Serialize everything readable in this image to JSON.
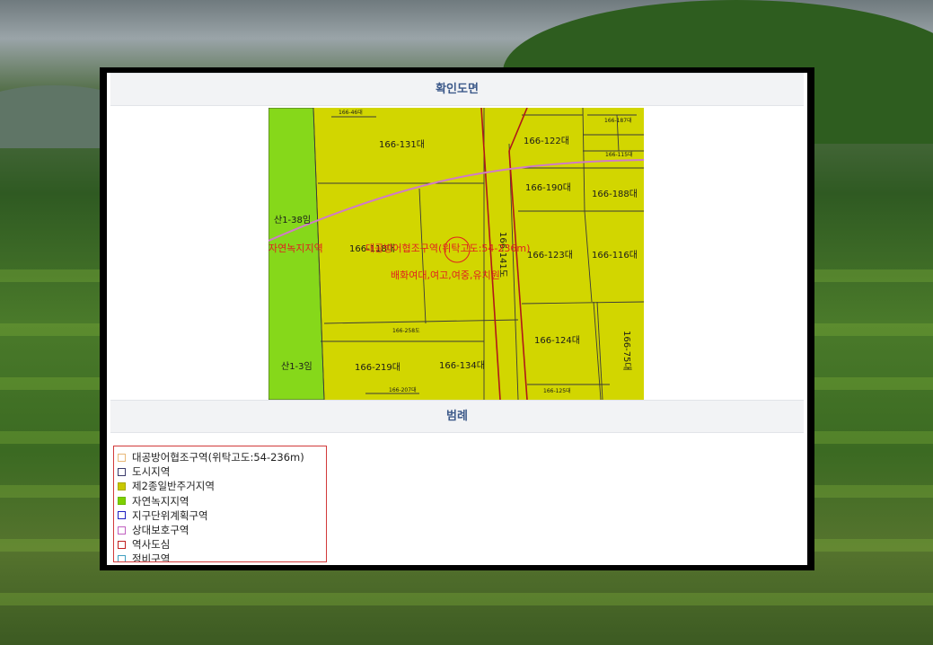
{
  "page": {
    "map_section_title": "확인도면",
    "legend_section_title": "범례"
  },
  "map": {
    "parcels": {
      "p1": "166-131대",
      "p2": "166-122대",
      "p3": "166-115대",
      "p4": "166-190대",
      "p5": "166-188대",
      "p6": "166-123대",
      "p7": "166-116대",
      "p8": "166-124대",
      "p9": "166-219대",
      "p10": "166-134대",
      "p11": "166-75대",
      "p12": "166-125대",
      "p13": "166-141도",
      "p14": "166-258도",
      "p15": "166-207대",
      "p16": "166-187대",
      "p17": "166-46대",
      "s1": "산1-38임",
      "s2": "산1-3임",
      "h1": "166-118대"
    },
    "zone_labels": {
      "z1": "자연녹지지역",
      "z2": "대공방어협조구역(위탁고도:54-236m)",
      "z3": "배화여대,여고,여중,유치원"
    }
  },
  "legend": {
    "items": [
      {
        "label": "대공방어협조구역(위탁고도:54-236m)",
        "border": "#e8b878",
        "fill": "#ffffff"
      },
      {
        "label": "도시지역",
        "border": "#3a3a6a",
        "fill": "#ffffff"
      },
      {
        "label": "제2종일반주거지역",
        "border": "#a8a800",
        "fill": "#c8c800"
      },
      {
        "label": "자연녹지지역",
        "border": "#6ab800",
        "fill": "#7fd000"
      },
      {
        "label": "지구단위계획구역",
        "border": "#2020c0",
        "fill": "#ffffff"
      },
      {
        "label": "상대보호구역",
        "border": "#c060c0",
        "fill": "#ffffff"
      },
      {
        "label": "역사도심",
        "border": "#c02020",
        "fill": "#ffffff"
      },
      {
        "label": "정비구역",
        "border": "#40a0c0",
        "fill": "#ffffff"
      }
    ]
  },
  "colors": {
    "residential_zone": "#d2d600",
    "green_zone": "#86d81a",
    "road_line": "#b01818",
    "altitude_line": "#d07ac8",
    "section_title": "#3d5a8a",
    "legend_border": "#d23a3a"
  }
}
